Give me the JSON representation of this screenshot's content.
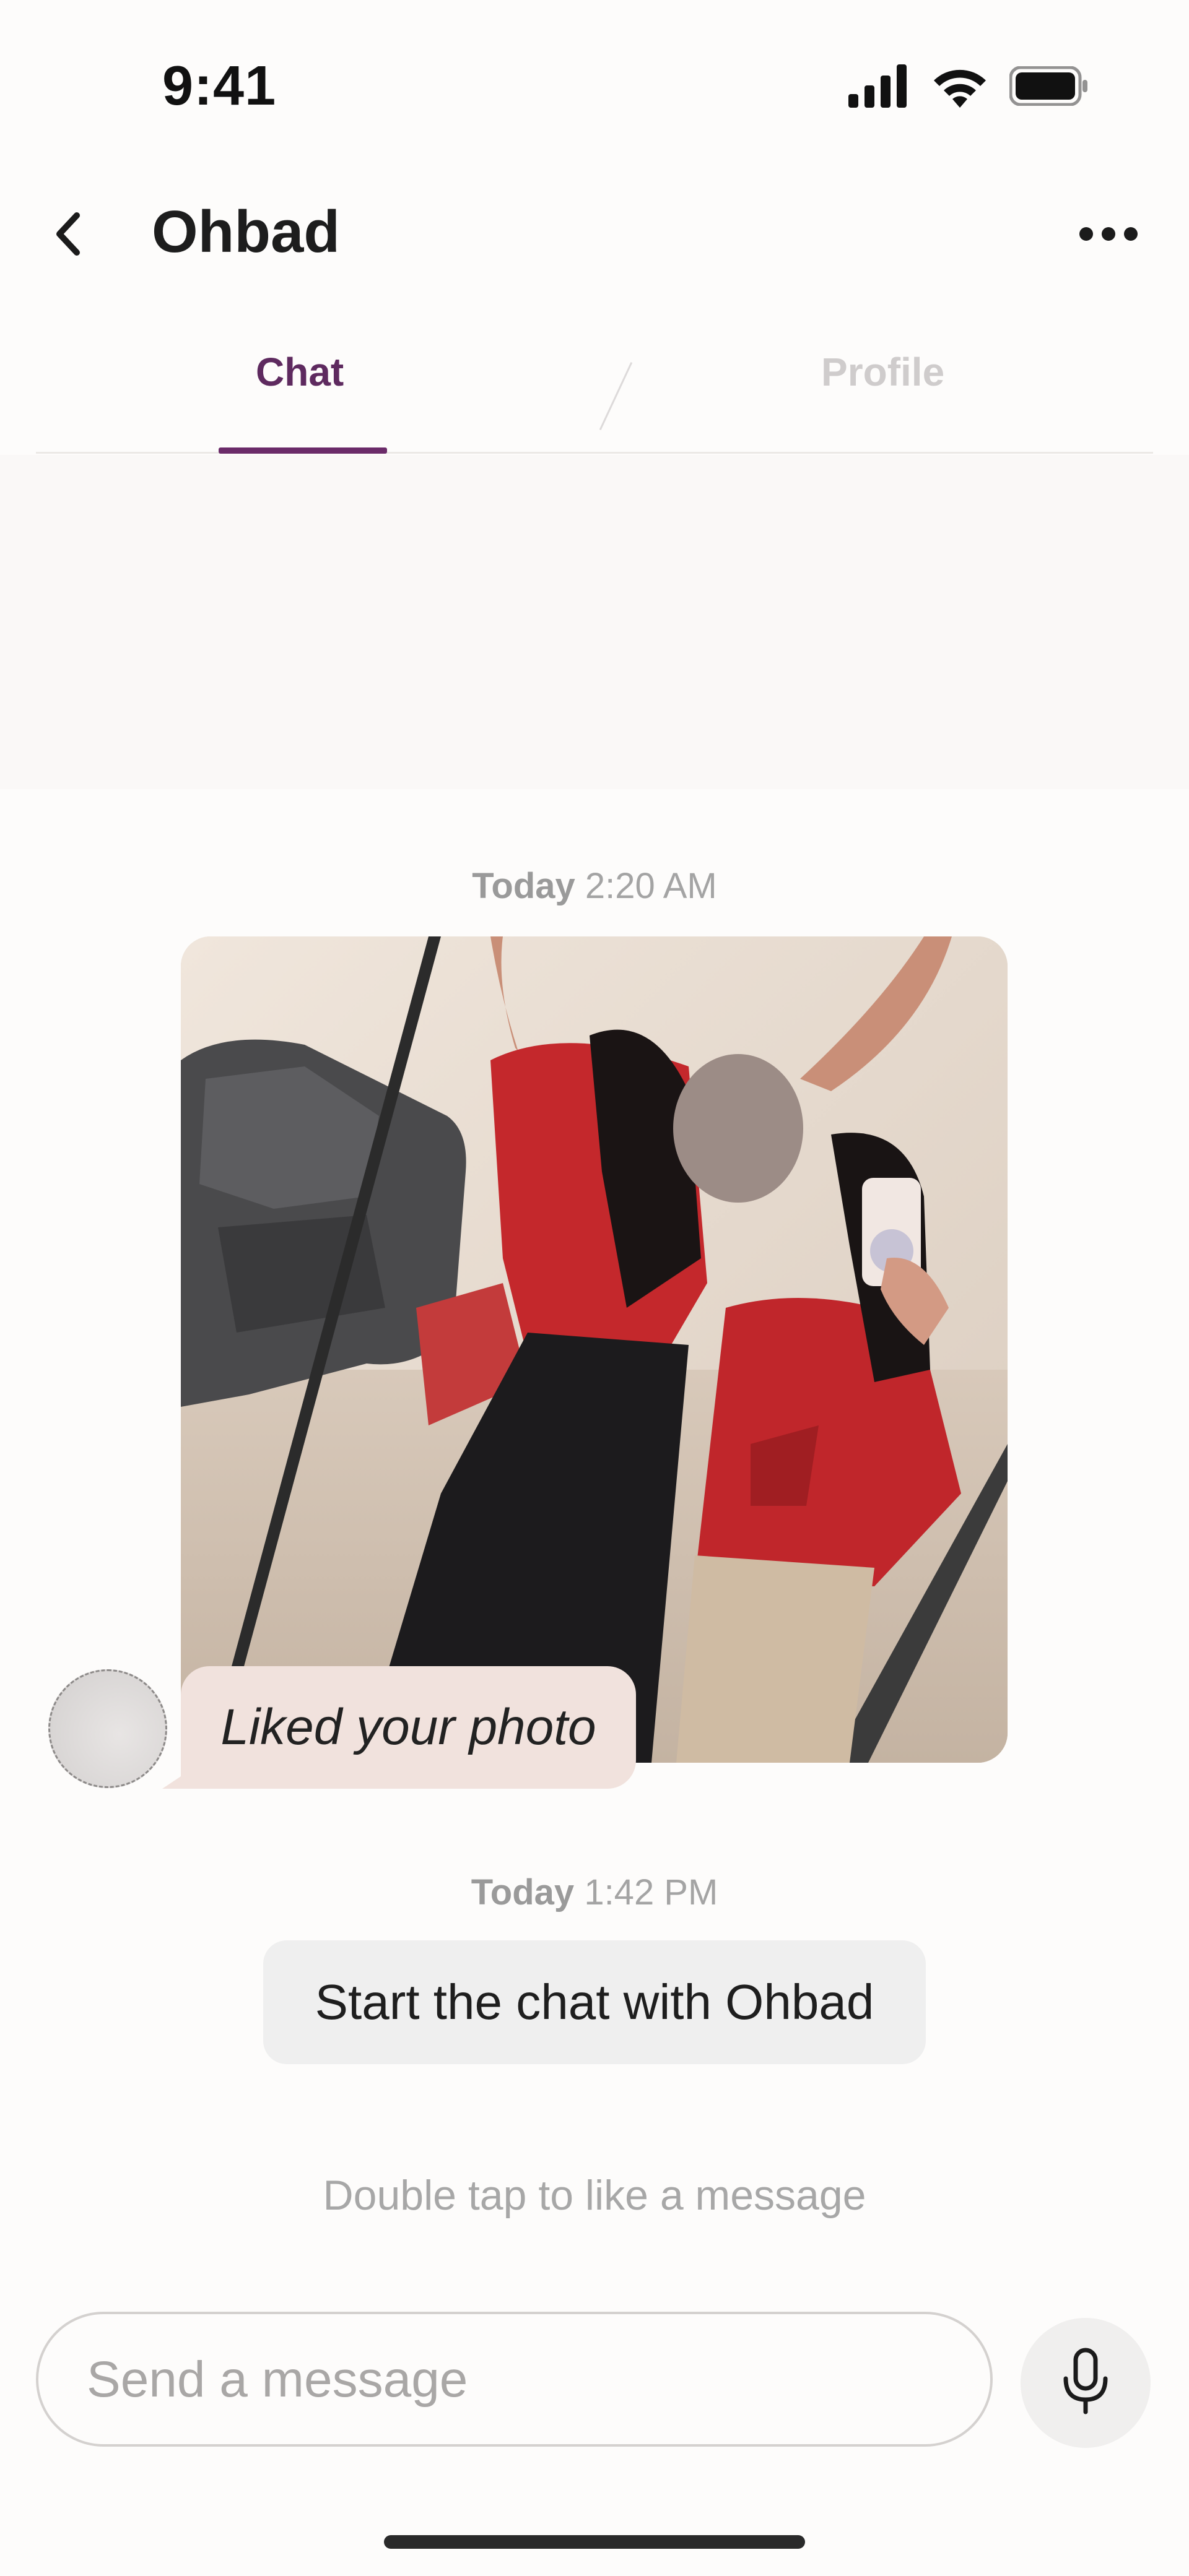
{
  "status_bar": {
    "time": "9:41",
    "icons": [
      "cellular-signal-icon",
      "wifi-icon",
      "battery-icon"
    ]
  },
  "header": {
    "title": "Ohbad",
    "back_icon": "chevron-left-icon",
    "more_icon": "more-horizontal-icon"
  },
  "tabs": [
    {
      "label": "Chat",
      "active": true
    },
    {
      "label": "Profile",
      "active": false
    }
  ],
  "messages": {
    "photo_timestamp": {
      "day": "Today",
      "time": "2:20 AM"
    },
    "photo_alt": "Photo of two people posing in a mirror wearing red shirts",
    "liked_text": "Liked your photo",
    "start_timestamp": {
      "day": "Today",
      "time": "1:42 PM"
    },
    "start_text": "Start the chat with Ohbad"
  },
  "hint": "Double tap to like a message",
  "composer": {
    "placeholder": "Send a message",
    "value": "",
    "mic_icon": "microphone-icon"
  },
  "colors": {
    "accent": "#6b2b69",
    "liked_bubble": "#f1e2dd",
    "start_bubble": "#efefef",
    "background": "#fdfcfb"
  }
}
